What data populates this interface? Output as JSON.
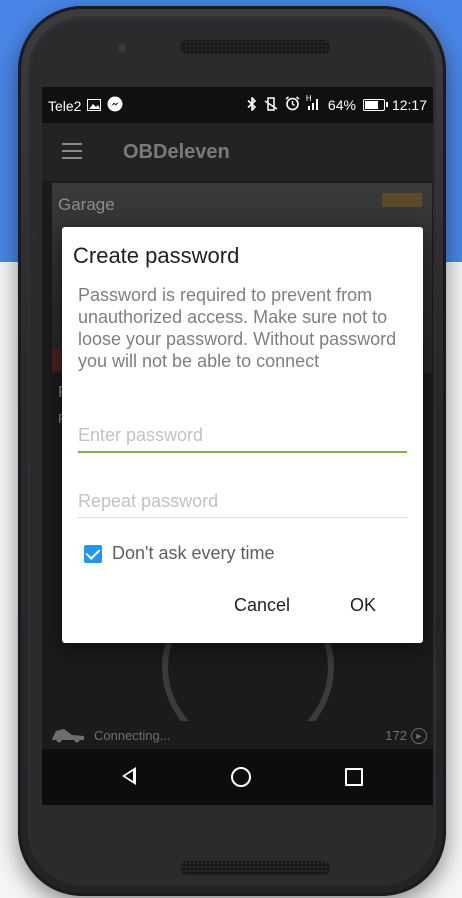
{
  "status_bar": {
    "carrier": "Tele2",
    "left_icons": [
      "image-icon",
      "messenger-icon"
    ],
    "right_icons": [
      "bluetooth-icon",
      "vibrate-icon",
      "alarm-icon",
      "signal-icon"
    ],
    "signal_label": "H",
    "battery_percent": "64%",
    "time": "12:17"
  },
  "app_bar": {
    "title": "OBDeleven",
    "menu_icon": "hamburger-icon"
  },
  "background": {
    "garage_label": "Garage",
    "side_letter_1": "P",
    "side_letter_2": "F",
    "connection_status": "Connecting...",
    "count": "172"
  },
  "dialog": {
    "title": "Create password",
    "message": "Password is required to prevent from unauthorized access. Make sure not to loose your password. Without password you will not be able to connect",
    "password_placeholder": "Enter password",
    "password_value": "",
    "repeat_placeholder": "Repeat password",
    "repeat_value": "",
    "checkbox_label": "Don't ask every time",
    "checkbox_checked": true,
    "cancel_label": "Cancel",
    "ok_label": "OK"
  },
  "nav_bar": {
    "back_icon": "back-icon",
    "home_icon": "home-icon",
    "recents_icon": "recents-icon"
  },
  "colors": {
    "background_blue": "#4a86e8",
    "accent_green": "#7cb342",
    "checkbox_blue": "#2196f3"
  }
}
